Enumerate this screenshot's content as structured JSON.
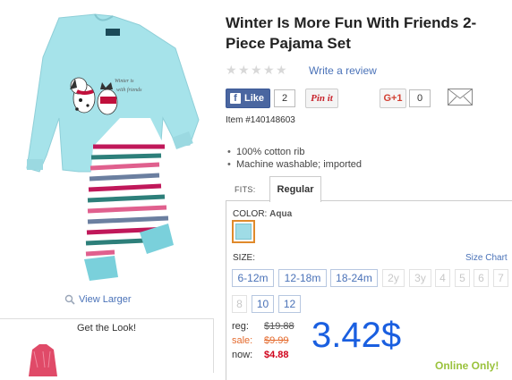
{
  "product": {
    "title": "Winter Is More Fun With Friends 2-Piece Pajama Set",
    "image_alt": "Winter Is More Fun With Friends 2-Piece Pajama Set",
    "view_larger": "View Larger",
    "item_number": "Item #140148603",
    "features": [
      "100% cotton rib",
      "Machine washable; imported"
    ]
  },
  "rating": {
    "stars_filled": 0,
    "stars_total": 5,
    "write_review": "Write a review"
  },
  "social": {
    "facebook_label": "Like",
    "facebook_count": "2",
    "pinterest_label": "Pin it",
    "gplus_label": "G+1",
    "gplus_count": "0"
  },
  "fits": {
    "label": "FITS:",
    "selected": "Regular"
  },
  "color": {
    "label": "COLOR:",
    "selected": "Aqua",
    "swatch_hex": "#9fdce6"
  },
  "size": {
    "label": "SIZE:",
    "chart_link": "Size Chart",
    "options": [
      {
        "label": "6-12m",
        "available": true
      },
      {
        "label": "12-18m",
        "available": true
      },
      {
        "label": "18-24m",
        "available": true
      },
      {
        "label": "2y",
        "available": false
      },
      {
        "label": "3y",
        "available": false
      },
      {
        "label": "4",
        "available": false
      },
      {
        "label": "5",
        "available": false
      },
      {
        "label": "6",
        "available": false
      },
      {
        "label": "7",
        "available": false
      },
      {
        "label": "8",
        "available": false
      },
      {
        "label": "10",
        "available": true
      },
      {
        "label": "12",
        "available": true
      }
    ]
  },
  "price": {
    "reg_label": "reg:",
    "reg_value": "$19.88",
    "sale_label": "sale:",
    "sale_value": "$9.99",
    "now_label": "now:",
    "now_value": "$4.88",
    "overlay_price": "3.42$",
    "online_only": "Online Only!"
  },
  "get_the_look": {
    "title": "Get the Look!"
  },
  "colors": {
    "link": "#4a72b8",
    "sale": "#e46b2e",
    "now": "#d0021b",
    "overlay_price": "#1a5fe0",
    "online_only": "#9ac23c",
    "facebook": "#4a66a0"
  }
}
